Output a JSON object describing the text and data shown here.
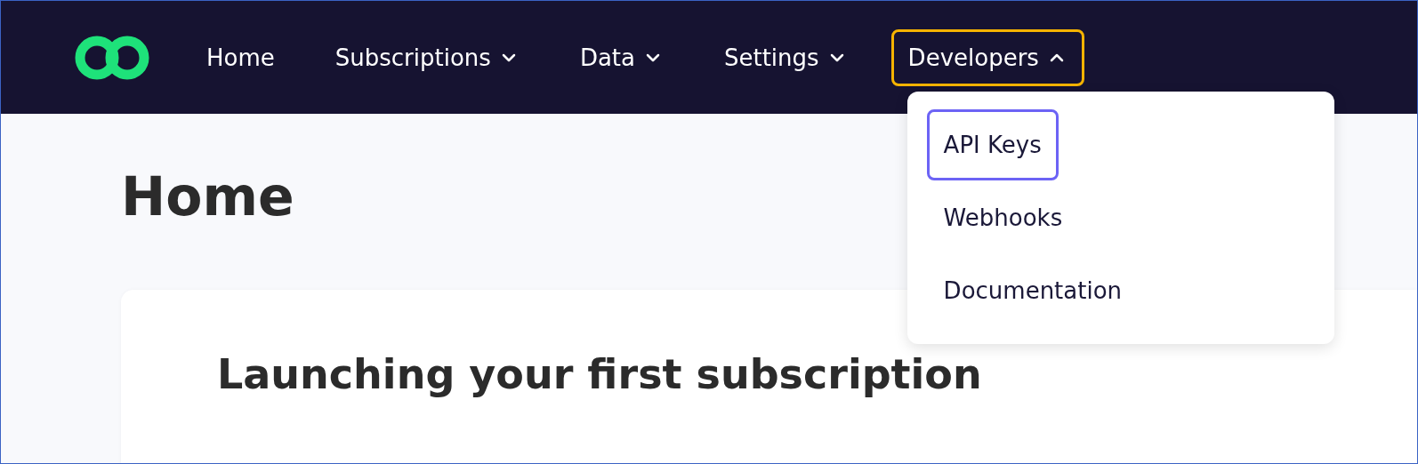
{
  "nav": {
    "items": [
      {
        "label": "Home",
        "focused": false
      },
      {
        "label": "Subscriptions",
        "expanded": false,
        "focused": false
      },
      {
        "label": "Data",
        "expanded": false,
        "focused": false
      },
      {
        "label": "Settings",
        "expanded": false,
        "focused": false
      },
      {
        "label": "Developers",
        "expanded": true,
        "focused": true,
        "menu": [
          {
            "label": "API Keys",
            "focused": true
          },
          {
            "label": "Webhooks",
            "focused": false
          },
          {
            "label": "Documentation",
            "focused": false
          }
        ]
      }
    ]
  },
  "page": {
    "title": "Home",
    "card": {
      "title": "Launching your first subscription"
    }
  }
}
